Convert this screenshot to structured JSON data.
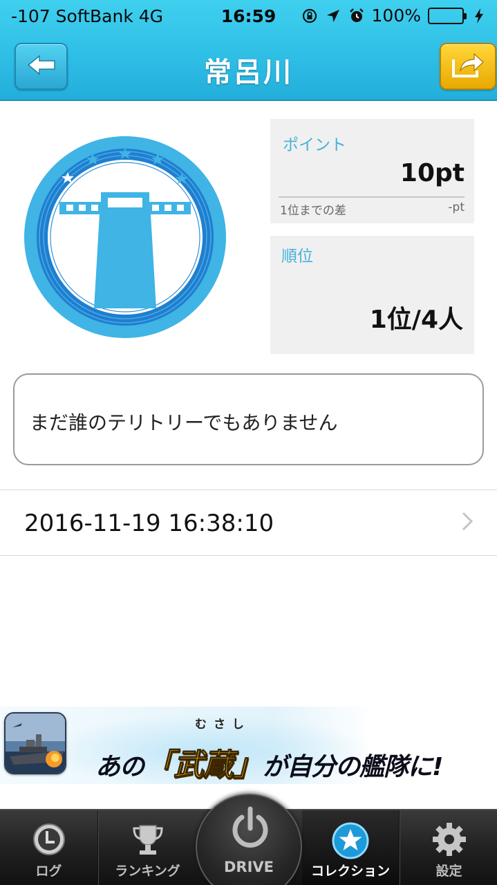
{
  "status_bar": {
    "carrier": "-107 SoftBank   4G",
    "time": "16:59",
    "battery": "100%"
  },
  "header": {
    "title": "常呂川",
    "back_icon": "arrow-left-icon",
    "share_icon": "share-arrow-icon"
  },
  "points_card": {
    "label": "ポイント",
    "value": "10pt",
    "diff_label": "1位までの差",
    "diff_value": "-pt"
  },
  "rank_card": {
    "label": "順位",
    "value": "1位/4人"
  },
  "territory": {
    "message": "まだ誰のテリトリーでもありません"
  },
  "history": [
    {
      "timestamp": "2016-11-19 16:38:10"
    }
  ],
  "ad": {
    "ruby": "むさし",
    "text_before": "あの",
    "highlight": "「武蔵」",
    "text_after": "が自分の艦隊に!"
  },
  "tabbar": {
    "tabs": [
      {
        "label": "ログ",
        "icon": "clock-icon"
      },
      {
        "label": "ランキング",
        "icon": "trophy-icon"
      },
      {
        "label": "DRIVE",
        "icon": "power-icon"
      },
      {
        "label": "コレクション",
        "icon": "star-circle-icon",
        "active": true
      },
      {
        "label": "設定",
        "icon": "gear-icon"
      }
    ]
  },
  "colors": {
    "header": "#2fbfe6",
    "accent_label": "#45b2db",
    "share_button": "#f5c400",
    "badge_outer": "#3fb4e5",
    "badge_ring": "#1e7fd0"
  }
}
